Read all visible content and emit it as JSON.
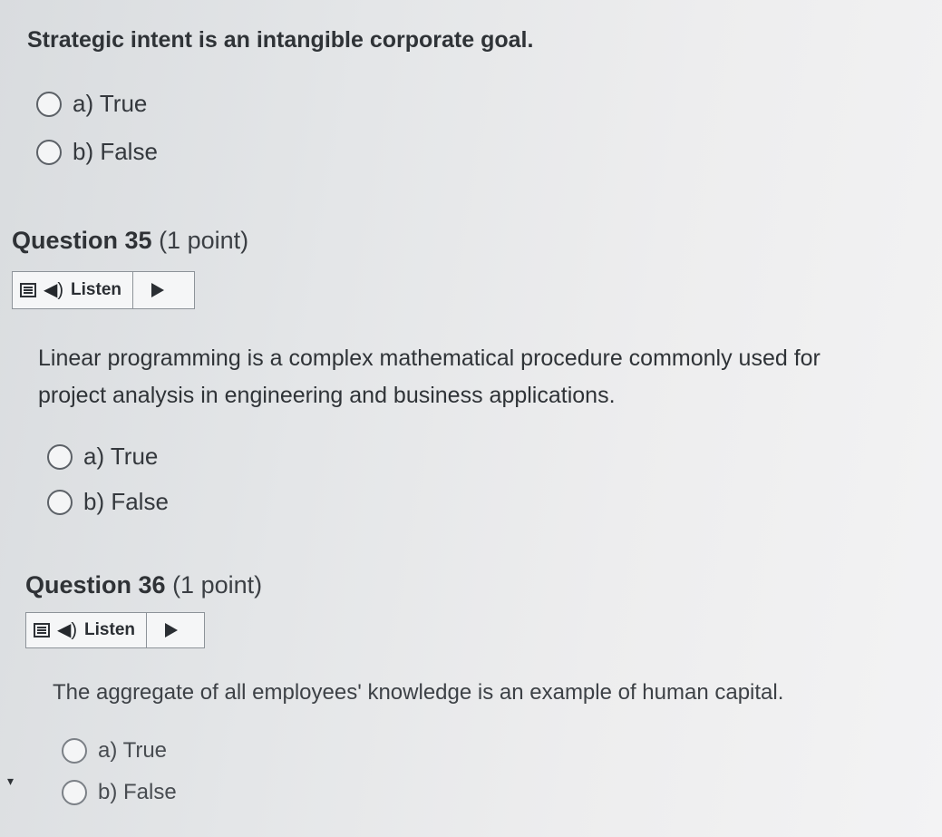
{
  "question34": {
    "prompt": "Strategic intent is an intangible corporate goal.",
    "options": [
      {
        "label": "a) True"
      },
      {
        "label": "b) False"
      }
    ]
  },
  "question35": {
    "title": "Question 35",
    "points": "(1 point)",
    "listen_label": "Listen",
    "prompt_line1": "Linear programming is a complex mathematical procedure commonly used for",
    "prompt_line2": "project analysis in engineering and business applications.",
    "options": [
      {
        "label": "a) True"
      },
      {
        "label": "b) False"
      }
    ]
  },
  "question36": {
    "title": "Question 36",
    "points": "(1 point)",
    "listen_label": "Listen",
    "prompt": "The aggregate of all employees' knowledge is an example of human capital.",
    "options": [
      {
        "label": "a) True"
      },
      {
        "label": "b) False"
      }
    ]
  },
  "icons": {
    "listen_menu": "menu-icon",
    "speaker": "speaker-icon",
    "play": "play-icon"
  }
}
